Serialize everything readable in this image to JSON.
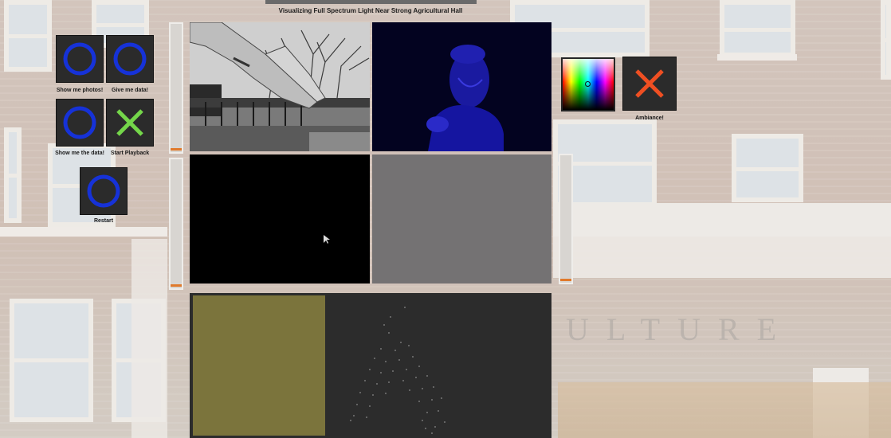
{
  "title": "Visualizing Full Spectrum Light Near Strong Agricultural Hall",
  "background": {
    "sign_text": "ULTURE"
  },
  "buttons": {
    "show_photos": {
      "label": "Show me photos!",
      "icon": "blue-ring-icon"
    },
    "give_data": {
      "label": "Give me data!",
      "icon": "blue-ring-icon"
    },
    "show_data": {
      "label": "Show me the data!",
      "icon": "blue-ring-icon"
    },
    "start_playback": {
      "label": "Start Playback",
      "icon": "green-x-icon"
    },
    "restart": {
      "label": "Restart",
      "icon": "blue-ring-icon"
    },
    "ambiance": {
      "label": "Ambiance!",
      "icon": "orange-x-icon"
    }
  },
  "colors": {
    "ring_blue": "#1632d8",
    "x_green": "#74d64a",
    "x_orange": "#ef4f22",
    "slider_thumb": "#e07a2c",
    "olive_swatch": "#7b743c",
    "gray_swatch": "#747273"
  }
}
